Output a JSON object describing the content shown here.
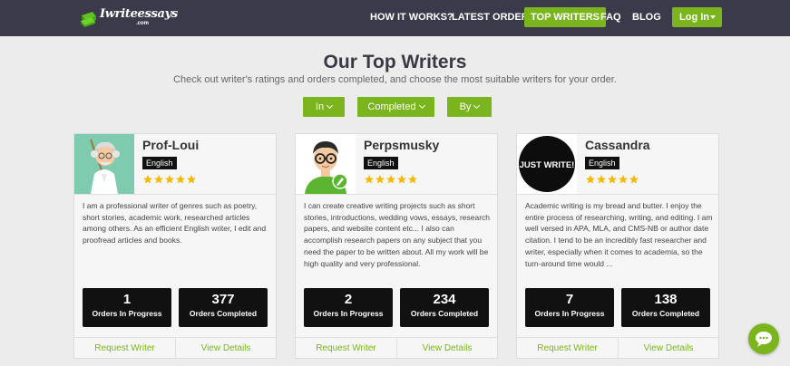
{
  "nav": {
    "logo_text": "Iwriteessays",
    "logo_sub": ".com",
    "links": [
      "HOW IT WORKS?",
      "LATEST ORDERS",
      "TOP WRITERS",
      "FAQ",
      "BLOG"
    ],
    "login": "Log In"
  },
  "header": {
    "title": "Our Top Writers",
    "subtitle": "Check out writer's ratings and orders completed, and choose the most suitable writers for your order."
  },
  "filters": [
    "In",
    "Completed",
    "By"
  ],
  "writers": [
    {
      "name": "Prof-Loui",
      "language": "English",
      "rating": 5,
      "bio": "I am a professional writer of genres such as poetry, short stories, academic work, researched articles among others. As an efficient English writer, I edit and proofread articles and books.",
      "in_progress": "1",
      "in_progress_label": "Orders In Progress",
      "completed": "377",
      "completed_label": "Orders Completed",
      "request": "Request Writer",
      "details": "View Details"
    },
    {
      "name": "Perpsmusky",
      "language": "English",
      "rating": 5,
      "bio": "I can create creative writing projects such as short stories, introductions, wedding vows, essays, research papers, and website content etc... I also can accomplish research papers on any subject that you need the paper to be written about. All my work will be high quality and very professional.",
      "in_progress": "2",
      "in_progress_label": "Orders In Progress",
      "completed": "234",
      "completed_label": "Orders Completed",
      "request": "Request Writer",
      "details": "View Details"
    },
    {
      "name": "Cassandra",
      "language": "English",
      "rating": 5,
      "avatar_text": "JUST WRITE!",
      "bio": "Academic writing is my bread and butter. I enjoy the entire process of researching, writing, and editing. I am well versed in APA, MLA, and CMS-NB or author date citation. I tend to be an incredibly fast researcher and writer, especially when it comes to academia, so the turn-around time would ...",
      "in_progress": "7",
      "in_progress_label": "Orders In Progress",
      "completed": "138",
      "completed_label": "Orders Completed",
      "request": "Request Writer",
      "details": "View Details"
    }
  ],
  "colors": {
    "accent": "#7ab51d",
    "navbar": "#3a3a4a",
    "star": "#f5b800"
  }
}
